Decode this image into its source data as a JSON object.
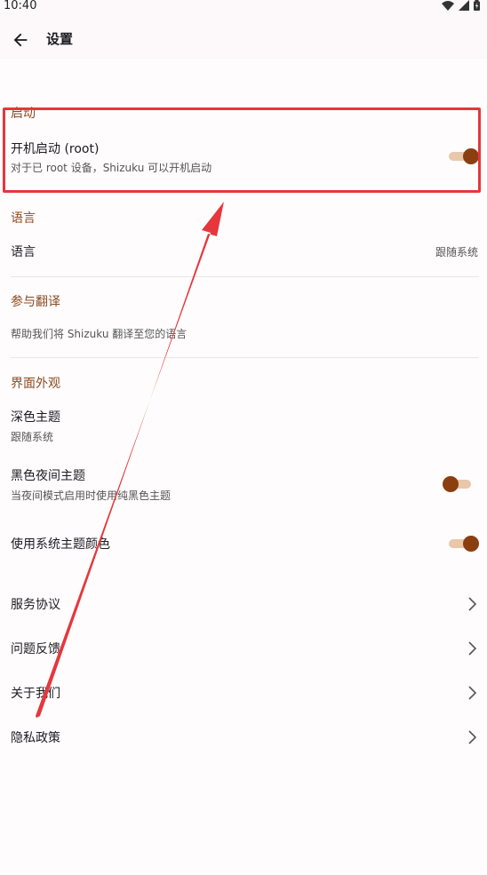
{
  "status": {
    "time": "10:40"
  },
  "appbar": {
    "title": "设置"
  },
  "sections": {
    "startup": {
      "header": "启动",
      "boot_title": "开机启动 (root)",
      "boot_sub": "对于已 root 设备，Shizuku 可以开机启动",
      "boot_enabled": true
    },
    "language": {
      "header": "语言",
      "lang_title": "语言",
      "lang_value": "跟随系统"
    },
    "translate": {
      "header": "参与翻译",
      "help_sub": "帮助我们将 Shizuku 翻译至您的语言"
    },
    "appearance": {
      "header": "界面外观",
      "dark_title": "深色主题",
      "dark_sub": "跟随系统",
      "black_title": "黑色夜间主题",
      "black_sub": "当夜间模式启用时使用纯黑色主题",
      "black_enabled": false,
      "system_color_title": "使用系统主题颜色",
      "system_color_enabled": true
    },
    "links": [
      {
        "label": "服务协议"
      },
      {
        "label": "问题反馈"
      },
      {
        "label": "关于我们"
      },
      {
        "label": "隐私政策"
      }
    ]
  },
  "colors": {
    "accent": "#8b3f10",
    "track": "#e9c7aa",
    "section_header": "#8a4b22",
    "annotation": "#e5373c"
  }
}
